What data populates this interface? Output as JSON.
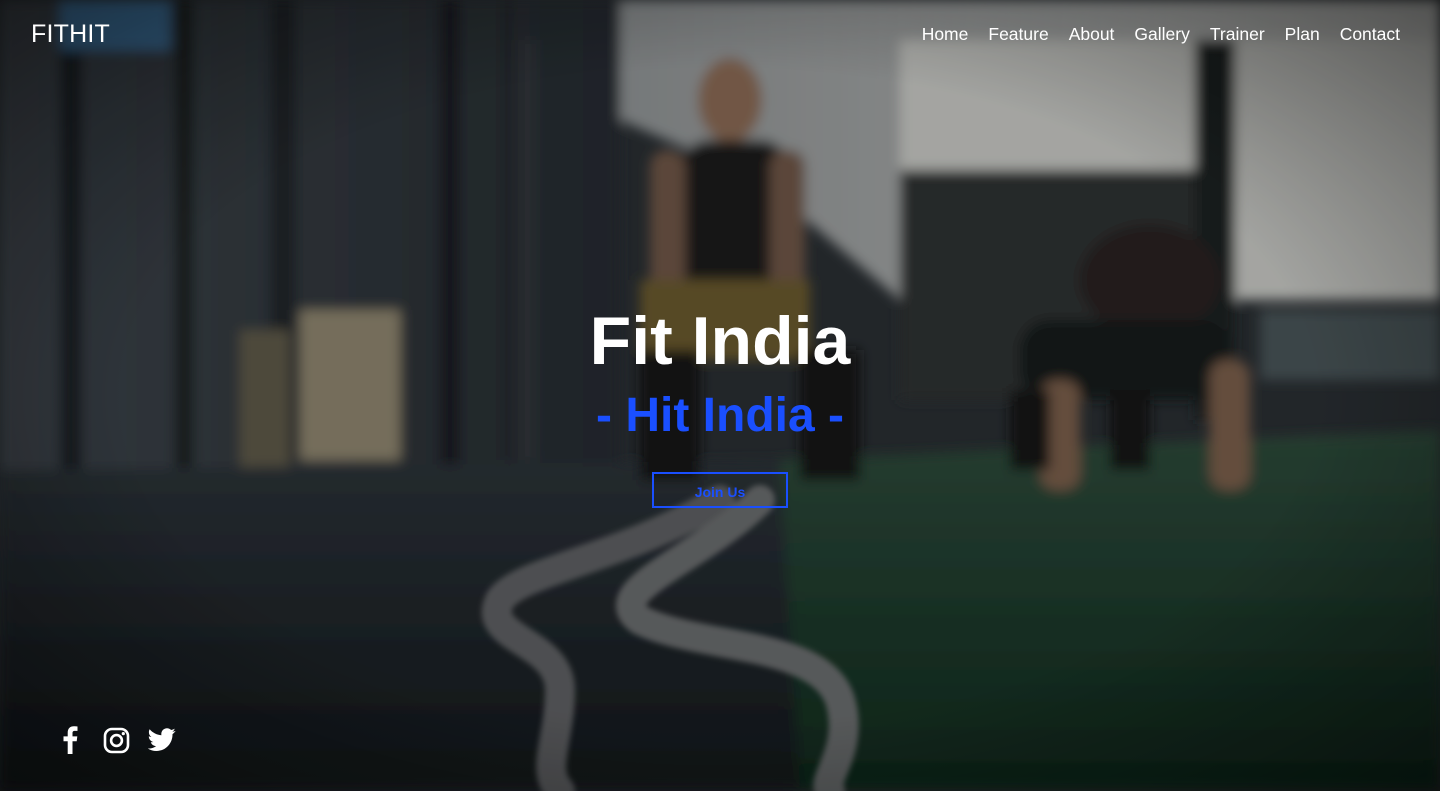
{
  "brand": {
    "name": "FITHIT"
  },
  "nav": {
    "items": [
      {
        "label": "Home"
      },
      {
        "label": "Feature"
      },
      {
        "label": "About"
      },
      {
        "label": "Gallery"
      },
      {
        "label": "Trainer"
      },
      {
        "label": "Plan"
      },
      {
        "label": "Contact"
      }
    ]
  },
  "hero": {
    "title": "Fit India",
    "subtitle": "- Hit India -",
    "cta_label": "Join Us"
  },
  "social": {
    "icons": [
      "facebook-icon",
      "instagram-icon",
      "twitter-icon"
    ]
  },
  "colors": {
    "accent": "#1a4fff",
    "text": "#ffffff"
  }
}
